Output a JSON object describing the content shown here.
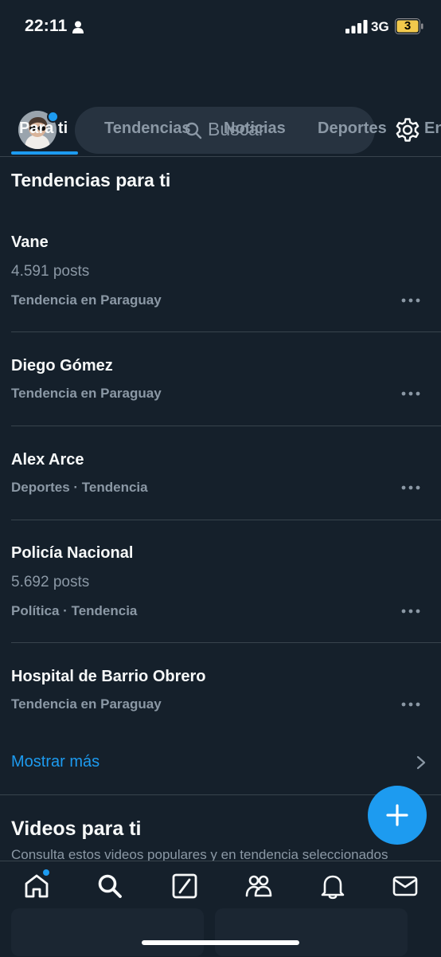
{
  "status_bar": {
    "time": "22:11",
    "network": "3G",
    "battery": "3"
  },
  "header": {
    "search_placeholder": "Buscar"
  },
  "tabs": [
    {
      "label": "Para ti",
      "active": true
    },
    {
      "label": "Tendencias"
    },
    {
      "label": "Noticias"
    },
    {
      "label": "Deportes"
    },
    {
      "label": "En"
    }
  ],
  "trends_section": {
    "title": "Tendencias para ti"
  },
  "trends": [
    {
      "name": "Vane",
      "posts": "4.591 posts",
      "context": "Tendencia en Paraguay"
    },
    {
      "name": "Diego Gómez",
      "context": "Tendencia en Paraguay"
    },
    {
      "name": "Alex Arce",
      "context": "Deportes · Tendencia"
    },
    {
      "name": "Policía Nacional",
      "posts": "5.692 posts",
      "context": "Política · Tendencia"
    },
    {
      "name": "Hospital de Barrio Obrero",
      "context": "Tendencia en Paraguay"
    }
  ],
  "show_more": "Mostrar más",
  "videos_section": {
    "title": "Videos para ti",
    "subtitle": "Consulta estos videos populares y en tendencia seleccionados"
  },
  "nav": [
    "home-icon",
    "search-icon",
    "grok-icon",
    "communities-icon",
    "notifications-icon",
    "messages-icon"
  ],
  "colors": {
    "background": "#15202b",
    "accent": "#1d9bf0",
    "secondary_text": "#8b98a5",
    "divider": "#38444d"
  }
}
